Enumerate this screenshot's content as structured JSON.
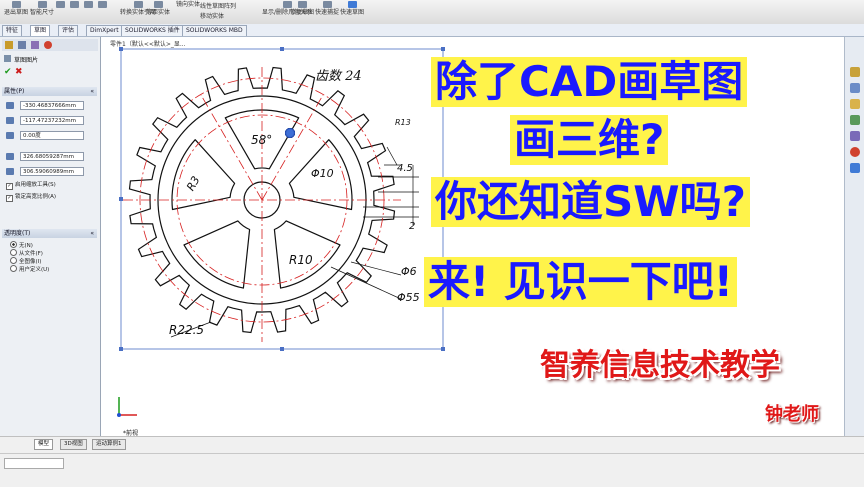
{
  "toolbar": {
    "items": [
      "退出草图",
      "智能尺寸",
      "",
      "",
      "",
      "",
      "",
      "",
      "转换实体引用",
      "等距实体",
      "镜向实体",
      "线性草图阵列",
      "移动实体",
      "显示/删除几何关系",
      "修复草图",
      "快速捕捉",
      "快速草图"
    ]
  },
  "command_tabs": [
    "特征",
    "草图",
    "评估",
    "DimXpert",
    "SOLIDWORKS 插件",
    "SOLIDWORKS MBD"
  ],
  "breadcrumb": "零件1（默认<<默认>_显...",
  "property_manager": {
    "title": "草图图片",
    "ok_symbol": "✔",
    "cancel_symbol": "✖",
    "properties_header": "属性(P)",
    "fields": [
      "-330.46837666mm",
      "-117.47237232mm",
      "0.00度",
      "326.68059287mm",
      "306.59060989mm"
    ],
    "checkboxes": [
      "启用缩放工具(S)",
      "锁定高宽比例(A)"
    ],
    "transparency_header": "透明度(T)",
    "radios": [
      "无(N)",
      "从文件(F)",
      "全图像(I)",
      "用户定义(U)"
    ],
    "selected_radio": 0
  },
  "drawing": {
    "teeth_label": "齿数 24",
    "dims": [
      "R13",
      "58°",
      "R3",
      "Φ10",
      "4.5",
      "2",
      "R10",
      "R22.5",
      "Φ6",
      "Φ55"
    ],
    "view_label": "*前视"
  },
  "bottom_tabs": [
    "模型",
    "3D视图",
    "运动算例1"
  ],
  "overlay": {
    "line1": "除了CAD画草图",
    "line2": "画三维?",
    "line3": "你还知道SW吗?",
    "line4": "来! 见识一下吧!",
    "brand": "智养信息技术教学",
    "teacher": "钟老师"
  },
  "colors": {
    "overlay_bg": "#fff34a",
    "overlay_text": "#1a1aff",
    "brand_red": "#e01818",
    "centerline_red": "#d62020",
    "panel_bg": "#edf0f4"
  }
}
